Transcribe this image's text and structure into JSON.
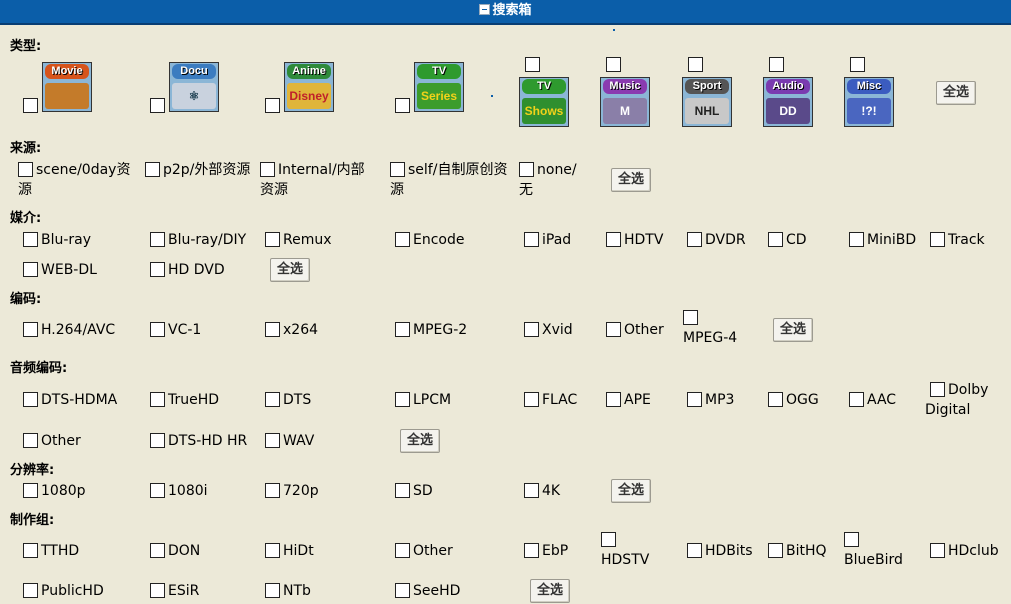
{
  "title": "搜索箱",
  "select_all": "全选",
  "sections": {
    "type": "类型:",
    "source": "来源:",
    "medium": "媒介:",
    "codec": "编码:",
    "audio": "音频编码:",
    "resolution": "分辨率:",
    "team": "制作组:"
  },
  "categories": [
    {
      "label": "Movie",
      "sub": "",
      "color": "#d6541c"
    },
    {
      "label": "Docu",
      "sub": "⚛",
      "color": "#3b7cc0"
    },
    {
      "label": "Anime",
      "sub": "Disney",
      "color": "#2e8a3a"
    },
    {
      "label": "TV",
      "sub": "Series",
      "color": "#2e9a2e"
    },
    {
      "label": "TV",
      "sub": "Shows",
      "color": "#2e9a2e"
    },
    {
      "label": "Music",
      "sub": "M",
      "color": "#8a3bb0"
    },
    {
      "label": "Sport",
      "sub": "NHL",
      "color": "#555555"
    },
    {
      "label": "Audio",
      "sub": "DD",
      "color": "#7a3bb0"
    },
    {
      "label": "Misc",
      "sub": "!?!",
      "color": "#3b5cc0"
    }
  ],
  "source": [
    "scene/0day资源",
    "p2p/外部资源",
    "Internal/内部资源",
    "self/自制原创资源",
    "none/无"
  ],
  "medium": [
    "Blu-ray",
    "Blu-ray/DIY",
    "Remux",
    "Encode",
    "iPad",
    "HDTV",
    "DVDR",
    "CD",
    "MiniBD",
    "Track",
    "WEB-DL",
    "HD DVD"
  ],
  "codec": [
    "H.264/AVC",
    "VC-1",
    "x264",
    "MPEG-2",
    "Xvid",
    "Other",
    "MPEG-4"
  ],
  "audio": [
    "DTS-HDMA",
    "TrueHD",
    "DTS",
    "LPCM",
    "FLAC",
    "APE",
    "MP3",
    "OGG",
    "AAC",
    "Dolby Digital",
    "Other",
    "DTS-HD HR",
    "WAV"
  ],
  "resolution": [
    "1080p",
    "1080i",
    "720p",
    "SD",
    "4K"
  ],
  "team": [
    "TTHD",
    "DON",
    "HiDt",
    "Other",
    "EbP",
    "HDSTV",
    "HDBits",
    "BitHQ",
    "BlueBird",
    "HDclub",
    "PublicHD",
    "ESiR",
    "NTb",
    "SeeHD"
  ]
}
